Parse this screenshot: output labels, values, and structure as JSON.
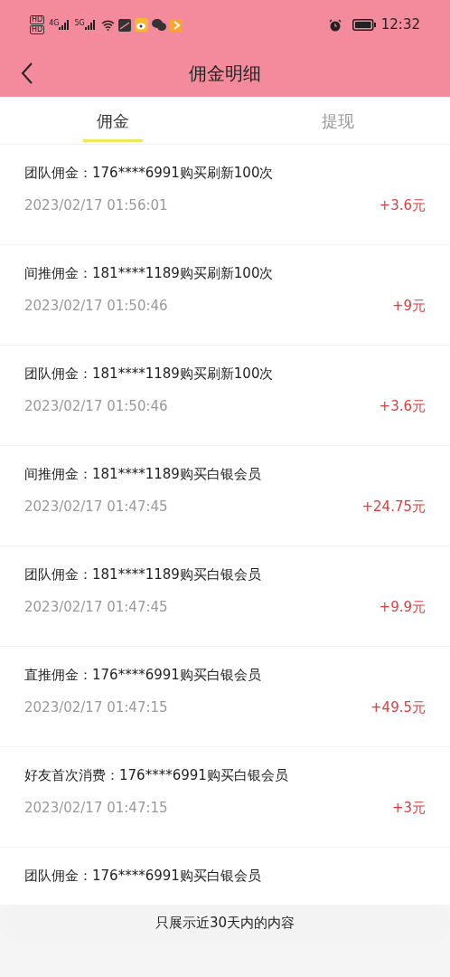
{
  "status_bar": {
    "hd_badges": [
      "HD",
      "HD"
    ],
    "networks": [
      "4G",
      "5G"
    ],
    "time": "12:32"
  },
  "header": {
    "title": "佣金明细"
  },
  "tabs": [
    {
      "label": "佣金",
      "selected": true
    },
    {
      "label": "提现",
      "selected": false
    }
  ],
  "records": [
    {
      "title": "团队佣金：176****6991购买刷新100次",
      "time": "2023/02/17 01:56:01",
      "amount": "+3.6元"
    },
    {
      "title": "间推佣金：181****1189购买刷新100次",
      "time": "2023/02/17 01:50:46",
      "amount": "+9元"
    },
    {
      "title": "团队佣金：181****1189购买刷新100次",
      "time": "2023/02/17 01:50:46",
      "amount": "+3.6元"
    },
    {
      "title": "间推佣金：181****1189购买白银会员",
      "time": "2023/02/17 01:47:45",
      "amount": "+24.75元"
    },
    {
      "title": "团队佣金：181****1189购买白银会员",
      "time": "2023/02/17 01:47:45",
      "amount": "+9.9元"
    },
    {
      "title": "直推佣金：176****6991购买白银会员",
      "time": "2023/02/17 01:47:15",
      "amount": "+49.5元"
    },
    {
      "title": "好友首次消费：176****6991购买白银会员",
      "time": "2023/02/17 01:47:15",
      "amount": "+3元"
    },
    {
      "title": "团队佣金：176****6991购买白银会员"
    }
  ],
  "notice": "只展示近30天内的内容"
}
